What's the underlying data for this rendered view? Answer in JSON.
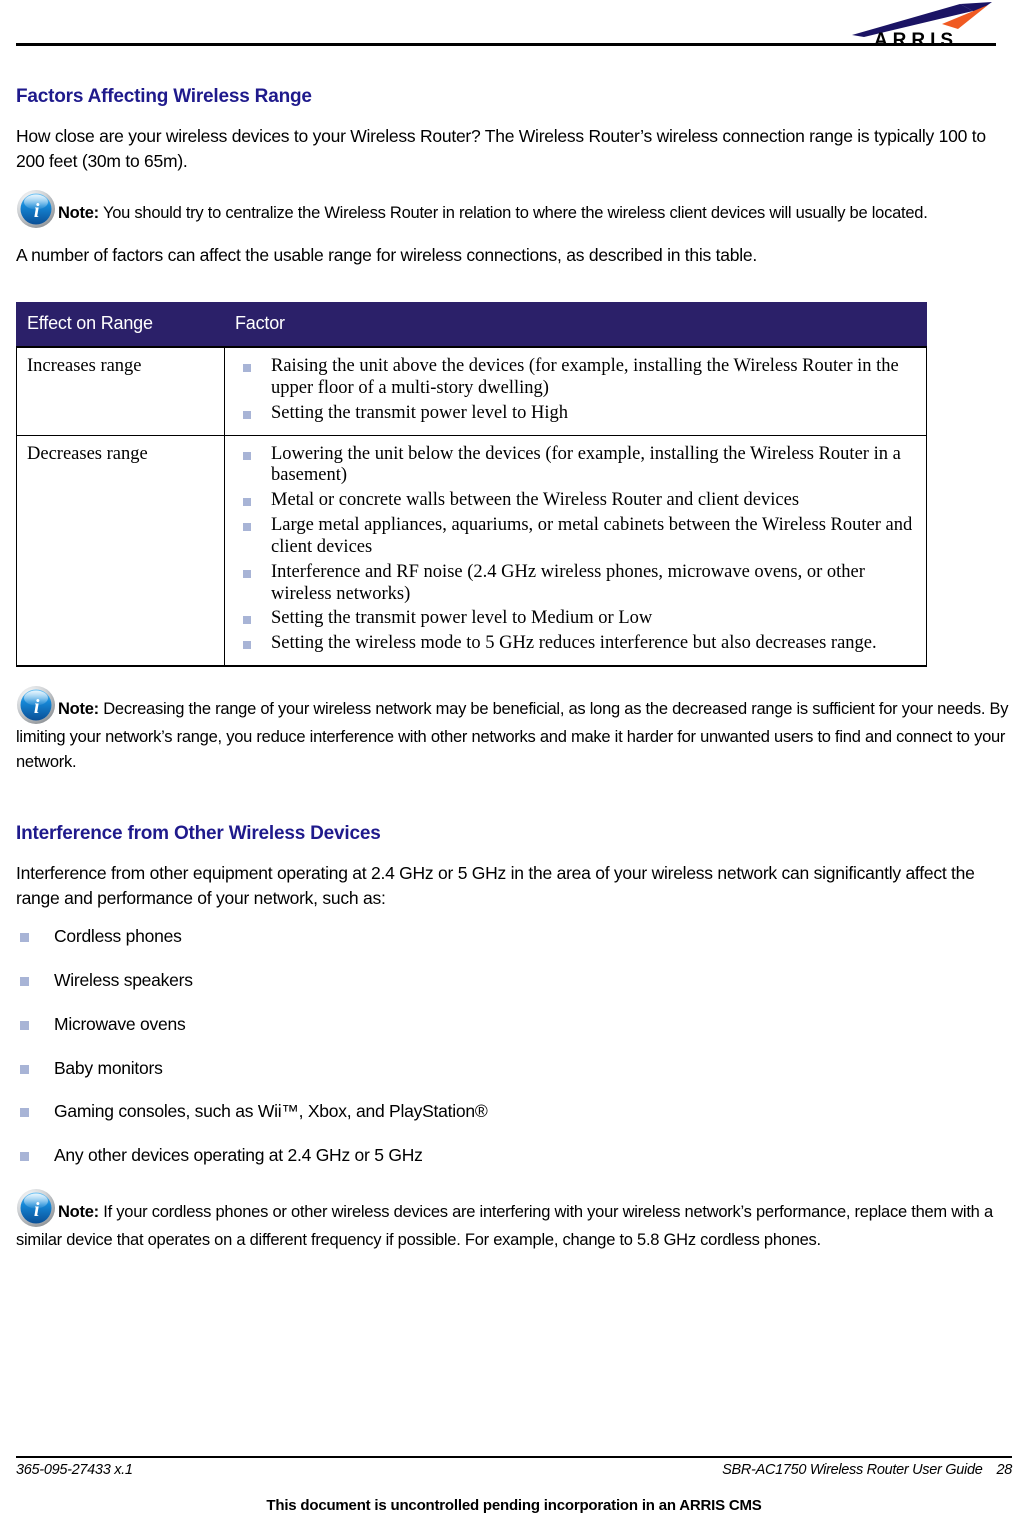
{
  "header": {
    "logo_text": "ARRIS",
    "logo_colors": {
      "swoosh_navy": "#1b1464",
      "swoosh_orange": "#f05a22",
      "wordmark": "#000000"
    }
  },
  "theme": {
    "heading_blue": "#1f1a8c",
    "table_header_bg": "#2b2069",
    "bullet_square": "#a8b4d6",
    "text_black": "#000000"
  },
  "sections": {
    "range": {
      "heading": "Factors Affecting Wireless Range",
      "paragraph_1": "How close are your wireless devices to your Wireless Router? The Wireless Router’s wireless connection range is typically 100 to 200 feet (30m to 65m).",
      "note_1": {
        "icon": "info-icon",
        "label": "Note:",
        "text": "You should try to centralize the Wireless Router in relation to where the wireless client devices will usually be located."
      },
      "paragraph_2": "A number of factors can affect the usable range for wireless connections, as described in this table.",
      "note_2": {
        "icon": "info-icon",
        "label": "Note:",
        "text": "Decreasing the range of your wireless network may be beneficial, as long as the decreased range is sufficient for your needs.  By limiting your network’s range, you reduce interference with other networks and make it harder for unwanted users to find and connect to your network."
      }
    },
    "interference": {
      "heading": "Interference from Other Wireless Devices",
      "paragraph_1": "Interference from other equipment operating at 2.4 GHz or 5 GHz in the area of your wireless network can significantly affect the range and performance of your network, such as:",
      "bullets": [
        "Cordless phones",
        "Wireless speakers",
        "Microwave ovens",
        "Baby monitors",
        "Gaming consoles, such as Wii™, Xbox, and PlayStation®",
        "Any other devices operating at 2.4 GHz or 5 GHz"
      ],
      "note_1": {
        "icon": "info-icon",
        "label": "Note:",
        "text": "If your cordless phones or other wireless devices are interfering with your wireless network’s performance, replace them with a similar device that operates on a different frequency if possible.  For example, change to 5.8 GHz cordless phones."
      }
    }
  },
  "table": {
    "columns": [
      "Effect on Range",
      "Factor"
    ],
    "rows": [
      {
        "effect": "Increases range",
        "factors": [
          "Raising the unit above the devices (for example, installing the Wireless Router in the upper floor of a multi-story dwelling)",
          "Setting the transmit power level to High"
        ]
      },
      {
        "effect": "Decreases range",
        "factors": [
          "Lowering the unit below the devices (for example, installing the Wireless Router in a basement)",
          "Metal or concrete walls between the Wireless Router and client devices",
          "Large metal appliances, aquariums, or metal cabinets between the Wireless Router and client devices",
          "Interference and RF noise (2.4 GHz wireless phones, microwave ovens, or other wireless networks)",
          "Setting the transmit power level to Medium or Low",
          "Setting the wireless mode to 5 GHz reduces interference but also decreases range."
        ]
      }
    ]
  },
  "footer": {
    "doc_number": "365-095-27433 x.1",
    "guide_title": "SBR-AC1750 Wireless Router User Guide",
    "page_number": "28",
    "disclaimer": "This document is uncontrolled pending incorporation in an ARRIS CMS"
  }
}
